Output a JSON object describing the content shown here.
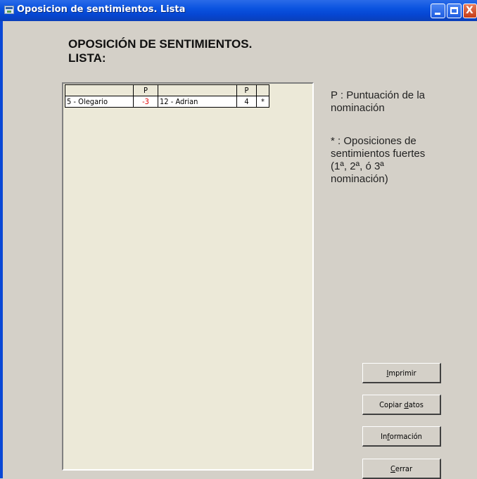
{
  "window": {
    "title": "Oposicion de sentimientos. Lista",
    "controls": {
      "close_glyph": "X"
    }
  },
  "heading": "OPOSICIÓN DE SENTIMIENTOS.\nLISTA:",
  "list": {
    "columns": [
      "",
      "P",
      "",
      "P",
      ""
    ],
    "rows": [
      {
        "name_a": "5 - Olegario",
        "p_a": "-3",
        "name_b": "12 - Adrian",
        "p_b": "4",
        "flag": "*"
      }
    ]
  },
  "legend": {
    "p_note": "P : Puntuación de la\nnominación",
    "star_note": "* : Oposiciones de\nsentimientos fuertes\n(1ª, 2ª, ó 3ª\nnominación)"
  },
  "buttons": {
    "print": {
      "pre": "",
      "ul": "I",
      "post": "mprimir"
    },
    "copy": {
      "pre": "Copiar ",
      "ul": "d",
      "post": "atos"
    },
    "info": {
      "pre": "In",
      "ul": "f",
      "post": "ormación"
    },
    "close": {
      "pre": "",
      "ul": "C",
      "post": "errar"
    }
  },
  "colors": {
    "titlebar": "#0a53e0",
    "window_bg": "#d4d0c8",
    "list_bg": "#ece9d8",
    "negative_value": "#e00000"
  },
  "icons": [
    "app-icon",
    "minimize-icon",
    "maximize-icon",
    "close-icon"
  ]
}
